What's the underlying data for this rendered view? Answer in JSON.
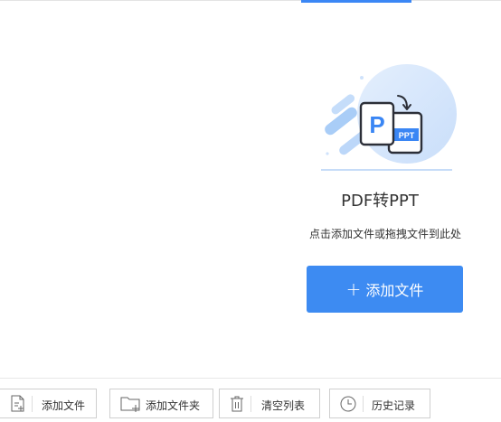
{
  "converter": {
    "title": "PDF转PPT",
    "hint": "点击添加文件或拖拽文件到此处",
    "primary_button_label": "添加文件",
    "illustration_front_letter": "P",
    "illustration_back_label": "PPT"
  },
  "toolbar": {
    "add_file_label": "添加文件",
    "add_folder_label": "添加文件夹",
    "clear_list_label": "清空列表",
    "history_label": "历史记录"
  },
  "colors": {
    "accent": "#3d8bf2"
  }
}
